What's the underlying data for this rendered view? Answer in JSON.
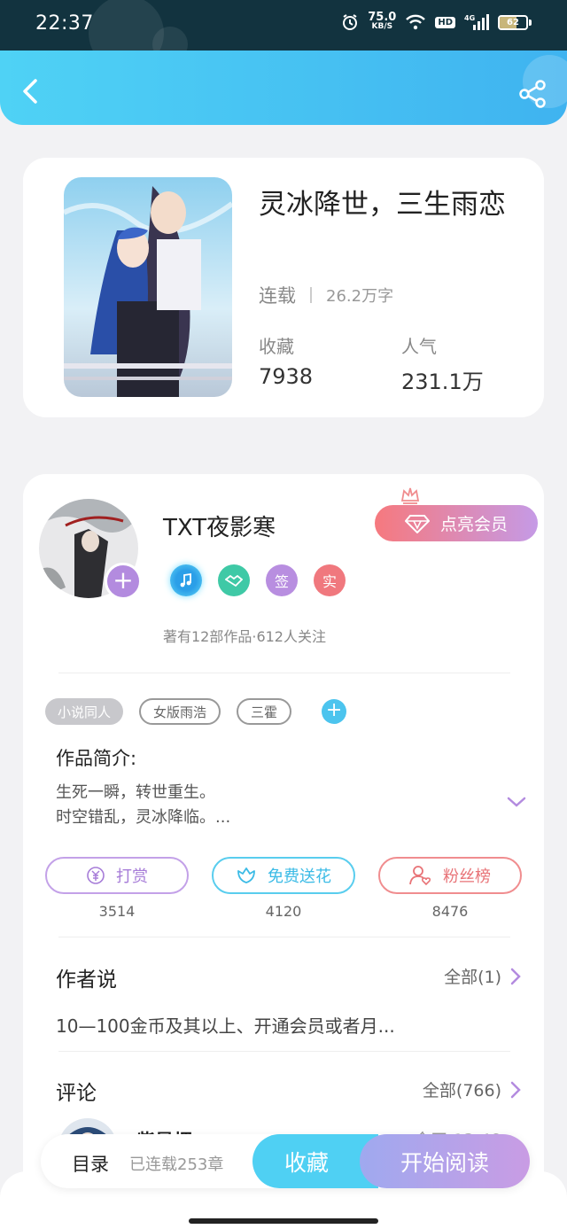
{
  "status_bar": {
    "time": "22:37",
    "net_speed_value": "75.0",
    "net_speed_unit": "KB/S",
    "hd": "HD",
    "signal": "4G",
    "battery": "62"
  },
  "book": {
    "title": "灵冰降世，三生雨恋",
    "status": "连载",
    "word_count": "26.2万字",
    "favorites_label": "收藏",
    "favorites_value": "7938",
    "popularity_label": "人气",
    "popularity_value": "231.1万"
  },
  "author": {
    "name": "TXT夜影寒",
    "vip_button": "点亮会员",
    "badges": [
      "签",
      "实"
    ],
    "meta": "著有12部作品·612人关注",
    "add": "+"
  },
  "tags": [
    "小说同人",
    "女版雨浩",
    "三霍"
  ],
  "tag_add": "+",
  "intro": {
    "title": "作品简介:",
    "line1": "生死一瞬，转世重生。",
    "line2": "时空错乱，灵冰降临。..."
  },
  "actions": [
    {
      "label": "打赏",
      "count": "3514"
    },
    {
      "label": "免费送花",
      "count": "4120"
    },
    {
      "label": "粉丝榜",
      "count": "8476"
    }
  ],
  "author_say": {
    "title": "作者说",
    "all": "全部(1)",
    "text": "10—100金币及其以上、开通会员或者月..."
  },
  "comments": {
    "title": "评论",
    "all": "全部(766)",
    "first_user": "紫曼烟",
    "first_time": "今天 13:48"
  },
  "bottom_bar": {
    "toc": "目录",
    "chapters": "已连载253章",
    "collect": "收藏",
    "read": "开始阅读"
  },
  "colors": {
    "header": "#4fd2f5",
    "accent_blue": "#4fd0f3",
    "accent_purple": "#c99ce4",
    "accent_red": "#f0787e"
  }
}
